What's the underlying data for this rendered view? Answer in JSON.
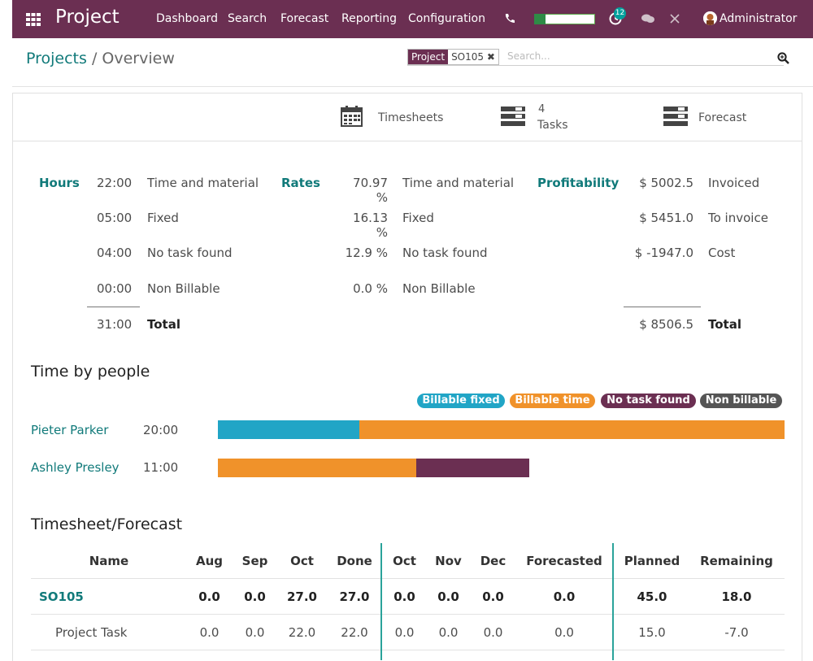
{
  "navbar": {
    "app_name": "Project",
    "menu": [
      "Dashboard",
      "Search",
      "Forecast",
      "Reporting",
      "Configuration"
    ],
    "notification_count": "12",
    "user": "Administrator"
  },
  "breadcrumb": {
    "parent": "Projects",
    "separator": "/",
    "current": "Overview"
  },
  "search": {
    "facet_label": "Project",
    "facet_value": "SO105",
    "placeholder": "Search..."
  },
  "stat_buttons": {
    "timesheets": "Timesheets",
    "tasks_count": "4",
    "tasks_label": "Tasks",
    "forecast": "Forecast"
  },
  "summary": {
    "hours_label": "Hours",
    "rates_label": "Rates",
    "profitability_label": "Profitability",
    "hours": [
      {
        "value": "22:00",
        "label": "Time and material"
      },
      {
        "value": "05:00",
        "label": "Fixed"
      },
      {
        "value": "04:00",
        "label": "No task found"
      },
      {
        "value": "00:00",
        "label": "Non Billable"
      }
    ],
    "hours_total": {
      "value": "31:00",
      "label": "Total"
    },
    "rates": [
      {
        "value": "70.97 %",
        "label": "Time and material"
      },
      {
        "value": "16.13 %",
        "label": "Fixed"
      },
      {
        "value": "12.9 %",
        "label": "No task found"
      },
      {
        "value": "0.0 %",
        "label": "Non Billable"
      }
    ],
    "profitability": [
      {
        "value": "$ 5002.5",
        "label": "Invoiced"
      },
      {
        "value": "$ 5451.0",
        "label": "To invoice"
      },
      {
        "value": "$ -1947.0",
        "label": "Cost"
      }
    ],
    "profitability_total": {
      "value": "$ 8506.5",
      "label": "Total"
    }
  },
  "time_by_people": {
    "title": "Time by people",
    "legend": [
      {
        "label": "Billable fixed",
        "color": "#21a5c6"
      },
      {
        "label": "Billable time",
        "color": "#f0922a"
      },
      {
        "label": "No task found",
        "color": "#6b2f52"
      },
      {
        "label": "Non billable",
        "color": "#555555"
      }
    ],
    "people": [
      {
        "name": "Pieter Parker",
        "time": "20:00",
        "segments": [
          {
            "type": "Billable fixed",
            "hours": 5
          },
          {
            "type": "Billable time",
            "hours": 15
          }
        ]
      },
      {
        "name": "Ashley Presley",
        "time": "11:00",
        "segments": [
          {
            "type": "Billable time",
            "hours": 7
          },
          {
            "type": "No task found",
            "hours": 4
          }
        ]
      }
    ]
  },
  "timesheet_forecast": {
    "title": "Timesheet/Forecast",
    "columns": [
      "Name",
      "Aug",
      "Sep",
      "Oct",
      "Done",
      "Oct",
      "Nov",
      "Dec",
      "Forecasted",
      "Planned",
      "Remaining"
    ],
    "rows": [
      {
        "name": "SO105",
        "values": [
          "0.0",
          "0.0",
          "27.0",
          "27.0",
          "0.0",
          "0.0",
          "0.0",
          "0.0",
          "45.0",
          "18.0"
        ]
      },
      {
        "name": "Project Task",
        "values": [
          "0.0",
          "0.0",
          "22.0",
          "22.0",
          "0.0",
          "0.0",
          "0.0",
          "0.0",
          "15.0",
          "-7.0"
        ]
      }
    ]
  }
}
